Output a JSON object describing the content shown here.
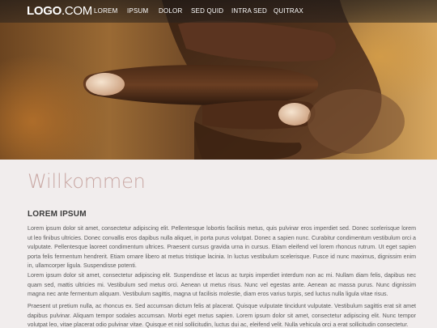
{
  "header": {
    "logo_bold": "LOGO",
    "logo_light": ".COM",
    "nav": [
      "LOREM",
      "IPSUM",
      "DOLOR",
      "SED QUID",
      "INTRA SED",
      "QUITRAX"
    ]
  },
  "main": {
    "title": "Willkommen",
    "section_heading": "LOREM IPSUM",
    "paragraphs": [
      "Lorem ipsum dolor sit amet, consectetur adipiscing elit. Pellentesque lobortis facilisis metus, quis pulvinar eros imperdiet sed. Donec scelerisque lorem ut leo finibus ultricies. Donec convallis eros dapibus nulla aliquet, in porta purus volutpat. Donec a sapien nunc. Curabitur condimentum vestibulum orci a vulputate. Pellentesque laoreet condimentum ultrices. Praesent cursus gravida urna in cursus. Etiam eleifend vel lorem rhoncus rutrum. Ut eget sapien porta felis fermentum hendrerit. Etiam ornare libero at metus tristique lacinia. In luctus vestibulum scelerisque. Fusce id nunc maximus, dignissim enim in, ullamcorper ligula. Suspendisse potenti.",
      "Lorem ipsum dolor sit amet, consectetur adipiscing elit. Suspendisse et lacus ac turpis imperdiet interdum non ac mi. Nullam diam felis, dapibus nec quam sed, mattis ultricies mi. Vestibulum sed metus orci. Aenean ut metus risus. Nunc vel egestas ante. Aenean ac massa purus. Nunc dignissim magna nec ante fermentum aliquam. Vestibulum sagittis, magna ut facilisis molestie, diam eros varius turpis, sed luctus nulla ligula vitae risus.",
      "Praesent ut pretium nulla, ac rhoncus ex. Sed accumsan dictum felis at placerat. Quisque vulputate tincidunt vulputate. Vestibulum sagittis erat sit amet dapibus pulvinar. Aliquam tempor sodales accumsan. Morbi eget metus sapien. Lorem ipsum dolor sit amet, consectetur adipiscing elit. Nunc tempor volutpat leo, vitae placerat odio pulvinar vitae. Quisque et nisl sollicitudin, luctus dui ac, eleifend velit. Nulla vehicula orci a erat sollicitudin consectetur."
    ]
  }
}
